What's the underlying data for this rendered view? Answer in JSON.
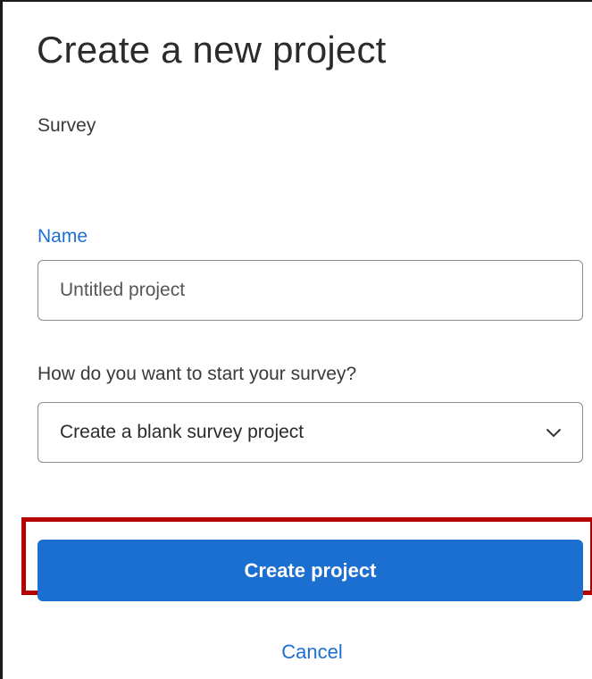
{
  "dialog": {
    "title": "Create a new project",
    "subtitle": "Survey"
  },
  "name_field": {
    "label": "Name",
    "value": "",
    "placeholder": "Untitled project"
  },
  "start_field": {
    "label": "How do you want to start your survey?",
    "selected": "Create a blank survey project",
    "icon": "chevron-down-icon"
  },
  "actions": {
    "create_label": "Create project",
    "cancel_label": "Cancel"
  },
  "colors": {
    "accent": "#1a6fd0",
    "highlight": "#b30000"
  }
}
